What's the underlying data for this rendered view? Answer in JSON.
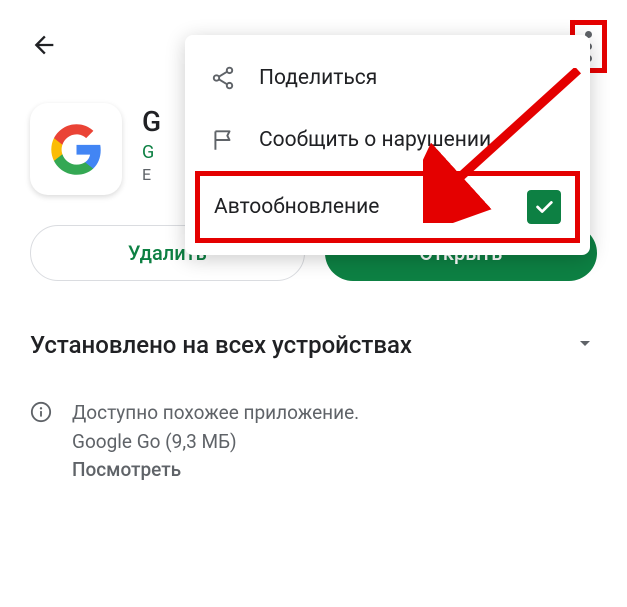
{
  "menu": {
    "share_label": "Поделиться",
    "report_label": "Сообщить о нарушении",
    "autoupdate_label": "Автообновление",
    "autoupdate_checked": true
  },
  "app": {
    "title": "G",
    "developer_prefix": "G",
    "misc_prefix": "Е"
  },
  "buttons": {
    "uninstall": "Удалить",
    "open": "Открыть"
  },
  "installed_section": {
    "title": "Установлено на всех устройствах"
  },
  "similar": {
    "line1": "Доступно похожее приложение.",
    "line2": "Google Go (9,3 МБ)",
    "link": "Посмотреть"
  },
  "annotations": {
    "highlight_color": "#e40000"
  }
}
